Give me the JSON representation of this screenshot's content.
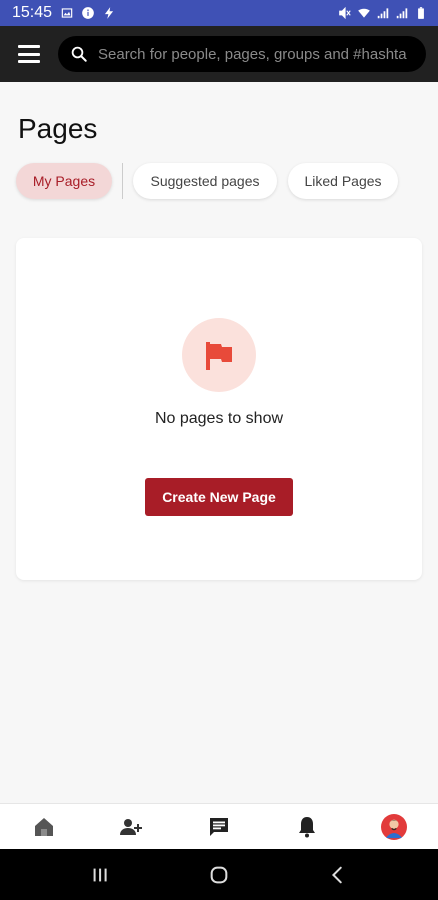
{
  "status_bar": {
    "time": "15:45",
    "left_icons": [
      "image-icon",
      "info-icon",
      "flash-icon"
    ],
    "right_icons": [
      "mute-icon",
      "wifi-icon",
      "signal-icon",
      "signal-2-icon",
      "battery-icon"
    ]
  },
  "header": {
    "search_placeholder": "Search for people, pages, groups and #hashta"
  },
  "page": {
    "title": "Pages"
  },
  "tabs": [
    {
      "label": "My Pages",
      "active": true
    },
    {
      "label": "Suggested pages",
      "active": false
    },
    {
      "label": "Liked Pages",
      "active": false
    }
  ],
  "empty_state": {
    "icon": "flag-icon",
    "message": "No pages to show",
    "button_label": "Create New Page"
  },
  "bottom_nav": {
    "items": [
      "home-icon",
      "add-friend-icon",
      "messages-icon",
      "notifications-icon",
      "profile-avatar"
    ]
  },
  "colors": {
    "accent": "#a81d27",
    "status_bar": "#3f51b5",
    "header": "#212121",
    "flag": "#e84a3a"
  }
}
